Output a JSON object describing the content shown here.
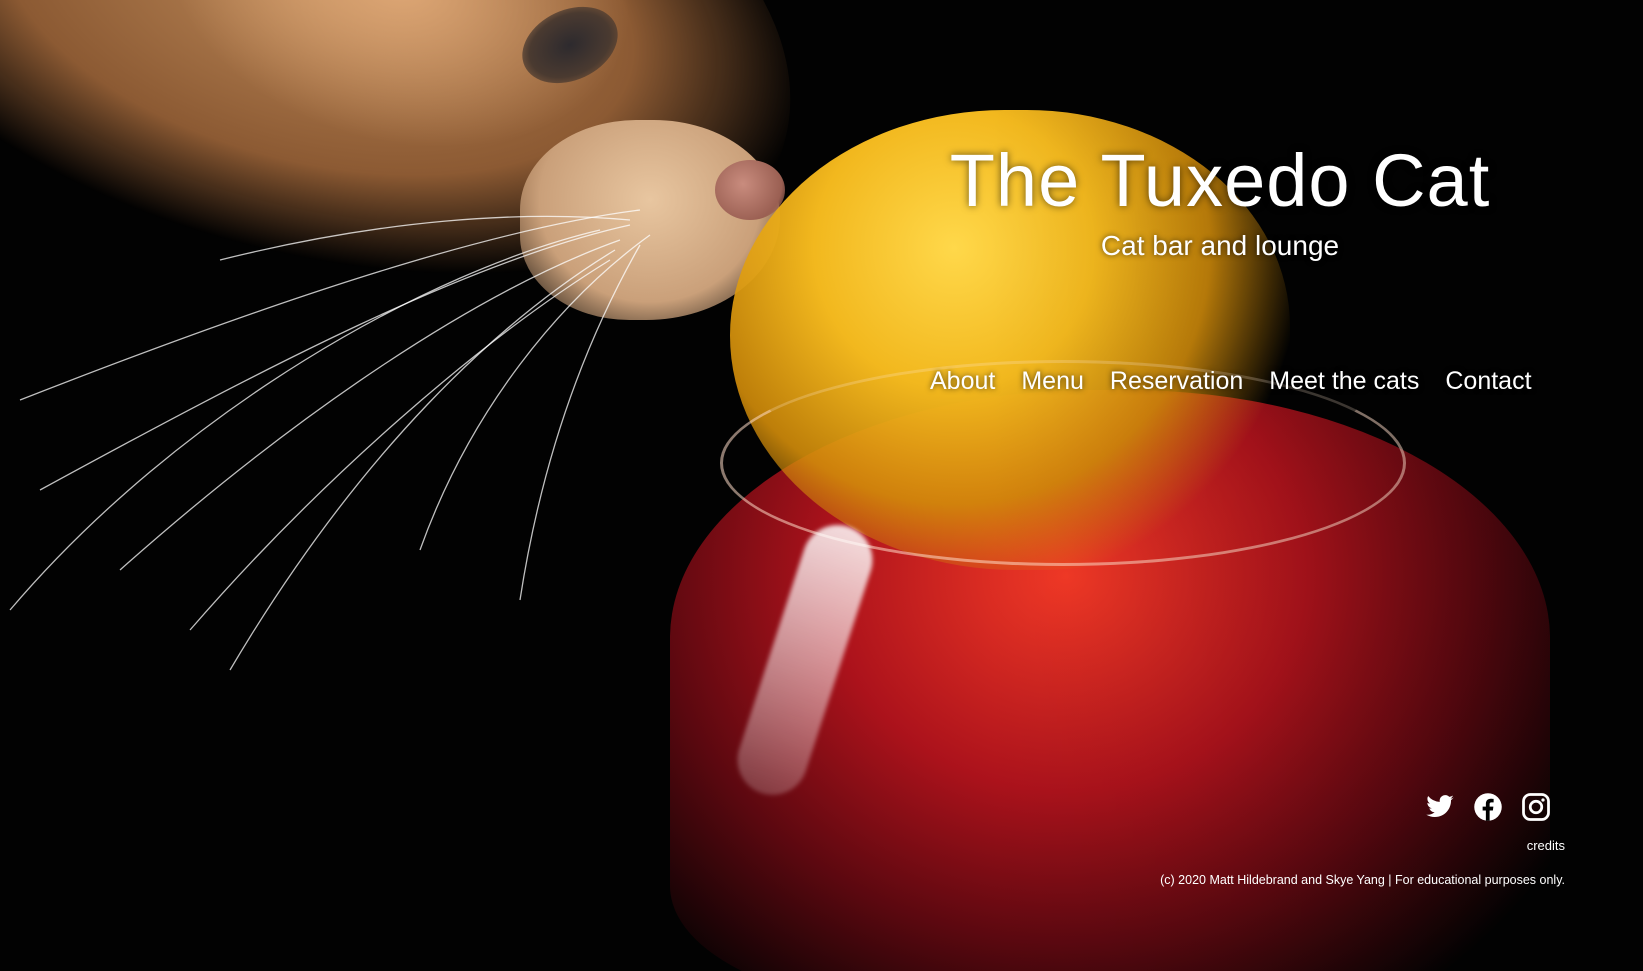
{
  "header": {
    "title": "The Tuxedo Cat",
    "subtitle": "Cat bar and lounge"
  },
  "nav": {
    "items": [
      {
        "label": "About"
      },
      {
        "label": "Menu"
      },
      {
        "label": "Reservation"
      },
      {
        "label": "Meet the cats"
      },
      {
        "label": "Contact"
      }
    ]
  },
  "footer": {
    "social": [
      {
        "icon": "twitter-icon"
      },
      {
        "icon": "facebook-icon"
      },
      {
        "icon": "instagram-icon"
      }
    ],
    "credits_label": "credits",
    "copyright": "(c) 2020 Matt Hildebrand and Skye Yang | For educational purposes only."
  },
  "colors": {
    "background": "#000000",
    "text": "#ffffff",
    "accent_flower": "#f2b81e",
    "accent_drink": "#c0141e"
  }
}
